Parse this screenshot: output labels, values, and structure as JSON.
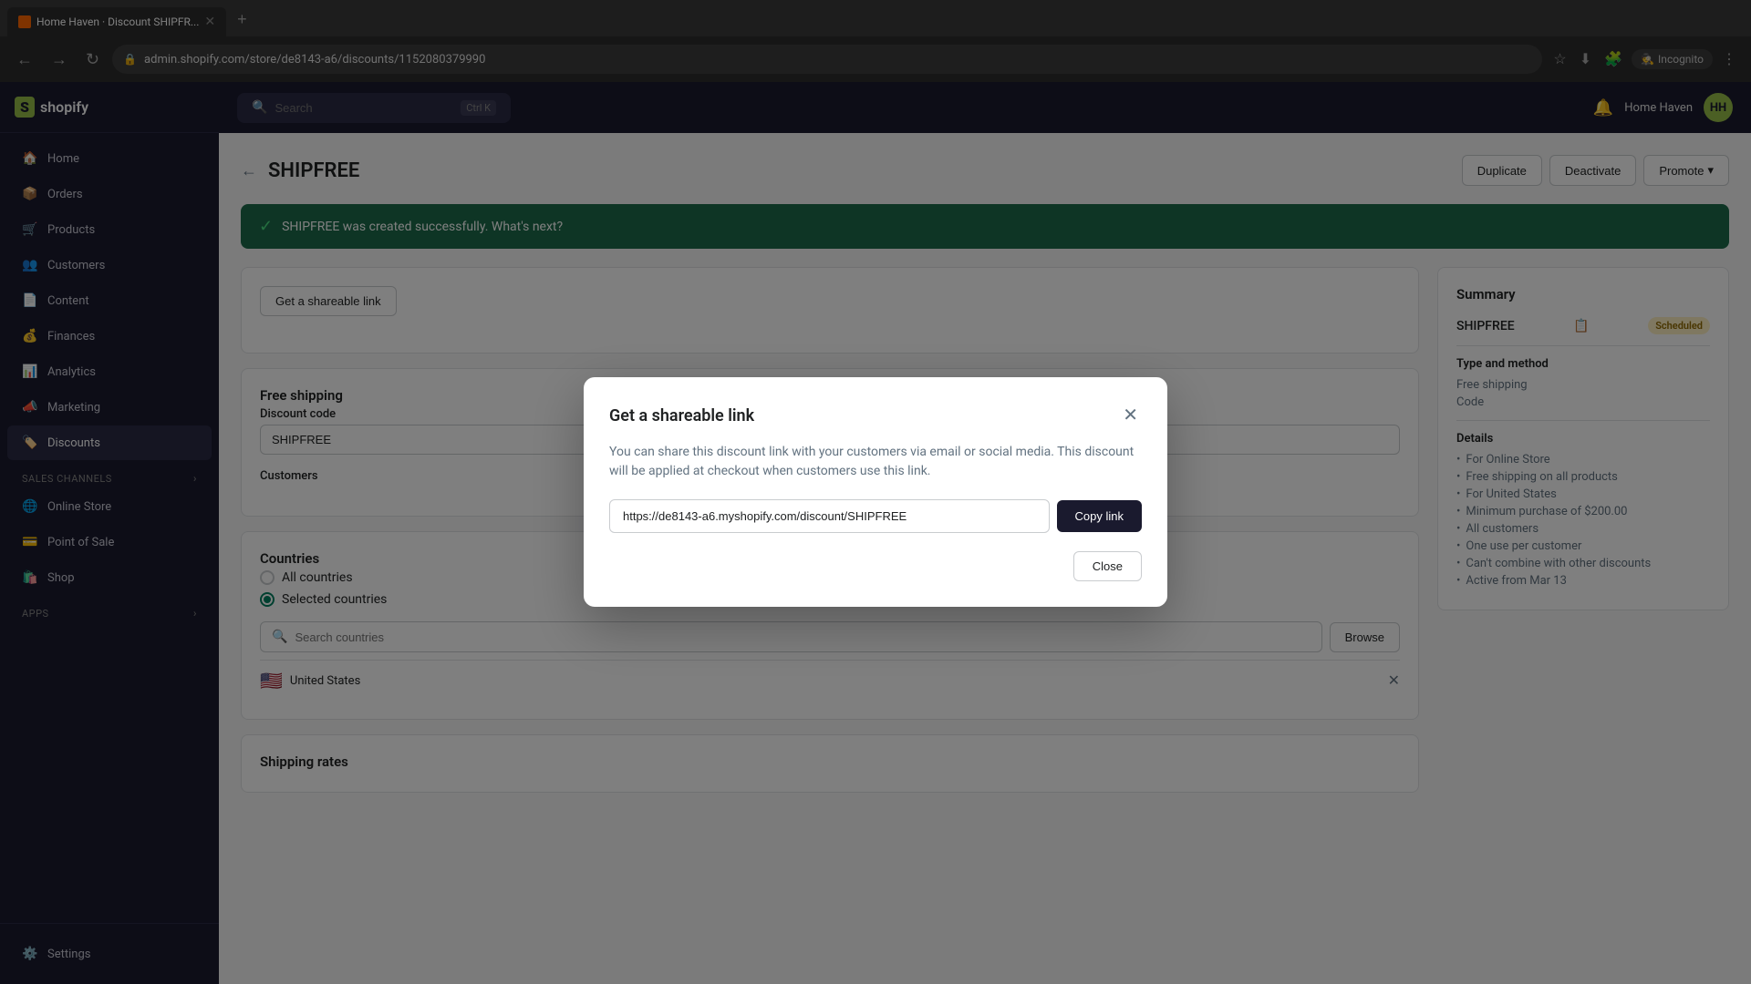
{
  "browser": {
    "tab_title": "Home Haven · Discount SHIPFR...",
    "url": "admin.shopify.com/store/de8143-a6/discounts/1152080379990",
    "incognito_label": "Incognito"
  },
  "topbar": {
    "search_placeholder": "Search",
    "search_shortcut": "Ctrl K",
    "store_name": "Home Haven",
    "avatar_initials": "HH"
  },
  "sidebar": {
    "logo": "shopify",
    "nav_items": [
      {
        "id": "home",
        "label": "Home",
        "icon": "🏠"
      },
      {
        "id": "orders",
        "label": "Orders",
        "icon": "📦"
      },
      {
        "id": "products",
        "label": "Products",
        "icon": "🛒"
      },
      {
        "id": "customers",
        "label": "Customers",
        "icon": "👥"
      },
      {
        "id": "content",
        "label": "Content",
        "icon": "📄"
      },
      {
        "id": "finances",
        "label": "Finances",
        "icon": "💰"
      },
      {
        "id": "analytics",
        "label": "Analytics",
        "icon": "📊"
      },
      {
        "id": "marketing",
        "label": "Marketing",
        "icon": "📣"
      },
      {
        "id": "discounts",
        "label": "Discounts",
        "icon": "🏷️"
      }
    ],
    "sales_channels_label": "Sales channels",
    "sales_channels": [
      {
        "id": "online-store",
        "label": "Online Store",
        "icon": "🌐"
      },
      {
        "id": "point-of-sale",
        "label": "Point of Sale",
        "icon": "💳"
      },
      {
        "id": "shop",
        "label": "Shop",
        "icon": "🛍️"
      }
    ],
    "apps_label": "Apps",
    "apps_expand_icon": "›",
    "settings_label": "Settings",
    "settings_icon": "⚙️"
  },
  "page": {
    "back_label": "←",
    "title": "SHIPFREE",
    "actions": {
      "duplicate": "Duplicate",
      "deactivate": "Deactivate",
      "promote": "Promote"
    }
  },
  "success_banner": {
    "text": "SHIPFREE was created successfully. What's next?"
  },
  "main_content": {
    "get_link_label": "Get a shareable link",
    "free_shipping_title": "Free shipping",
    "discount_code_label": "Discount code",
    "discount_code_placeholder": "SHIPFREE",
    "customers_label": "Customers",
    "countries": {
      "title": "Countries",
      "option_all": "All countries",
      "option_selected": "Selected countries",
      "search_placeholder": "Search countries",
      "browse_label": "Browse",
      "selected_countries": [
        {
          "flag": "🇺🇸",
          "name": "United States"
        }
      ]
    },
    "shipping_rates_title": "Shipping rates"
  },
  "summary": {
    "title": "Summary",
    "code": "SHIPFREE",
    "status_badge": "Scheduled",
    "type_and_method_title": "Type and method",
    "type": "Free shipping",
    "method": "Code",
    "details_title": "Details",
    "details": [
      "For Online Store",
      "Free shipping on all products",
      "For United States",
      "Minimum purchase of $200.00",
      "All customers",
      "One use per customer",
      "Can't combine with other discounts",
      "Active from Mar 13"
    ]
  },
  "modal": {
    "title": "Get a shareable link",
    "description": "You can share this discount link with your customers via email or social media. This discount will be applied at checkout when customers use this link.",
    "url": "https://de8143-a6.myshopify.com/discount/SHIPFREE",
    "copy_button": "Copy link",
    "close_button": "Close"
  }
}
